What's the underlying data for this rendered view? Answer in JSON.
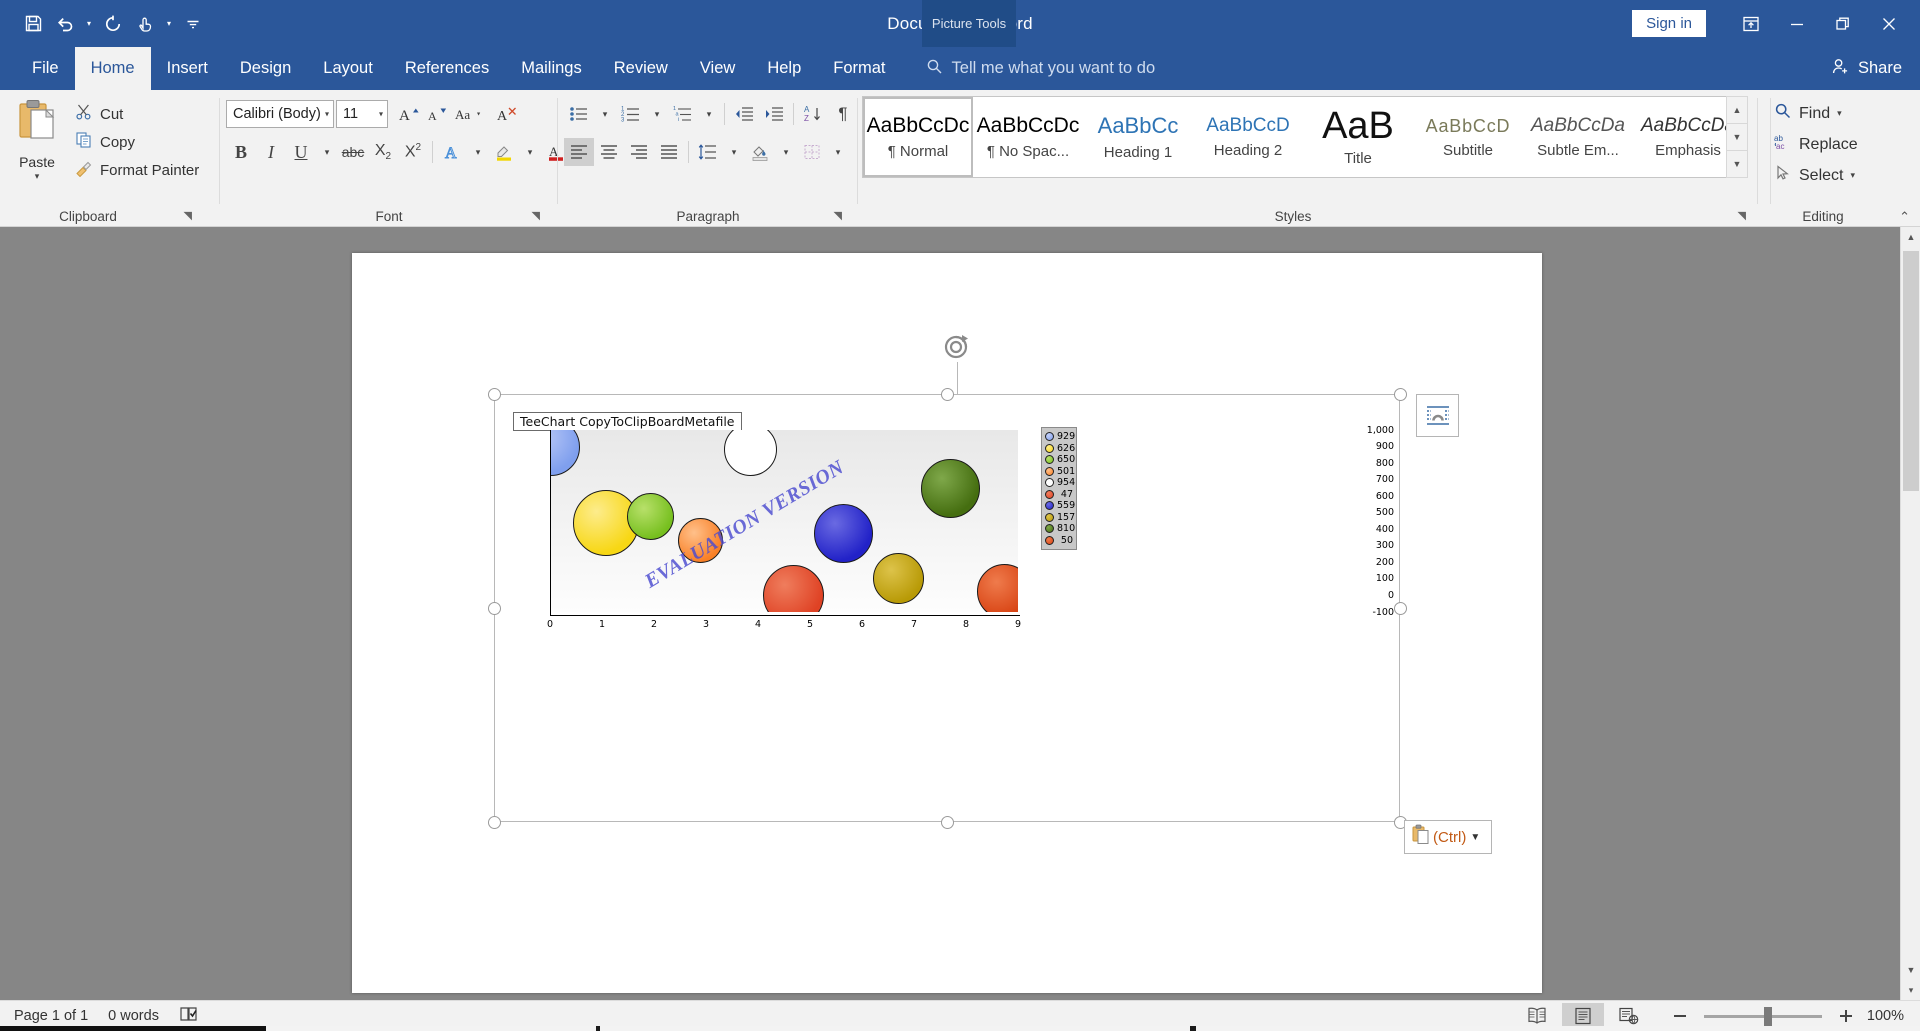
{
  "titlebar": {
    "document_title": "Document1  -  Word",
    "quick_access": [
      {
        "name": "save-icon",
        "label": "Save"
      },
      {
        "name": "undo-icon",
        "label": "Undo"
      },
      {
        "name": "redo-icon",
        "label": "Repeat"
      },
      {
        "name": "touch-mode-icon",
        "label": "Touch/Mouse Mode"
      },
      {
        "name": "customize-qat-icon",
        "label": "Customize Quick Access Toolbar"
      }
    ],
    "contextual_tab_group": "Picture Tools",
    "sign_in": "Sign in",
    "window_buttons": [
      {
        "name": "ribbon-display-options-icon",
        "label": "Ribbon Display Options"
      },
      {
        "name": "minimize-icon",
        "label": "Minimize"
      },
      {
        "name": "restore-icon",
        "label": "Restore Down"
      },
      {
        "name": "close-icon",
        "label": "Close"
      }
    ]
  },
  "tabs": [
    {
      "label": "File",
      "active": false
    },
    {
      "label": "Home",
      "active": true
    },
    {
      "label": "Insert",
      "active": false
    },
    {
      "label": "Design",
      "active": false
    },
    {
      "label": "Layout",
      "active": false
    },
    {
      "label": "References",
      "active": false
    },
    {
      "label": "Mailings",
      "active": false
    },
    {
      "label": "Review",
      "active": false
    },
    {
      "label": "View",
      "active": false
    },
    {
      "label": "Help",
      "active": false
    },
    {
      "label": "Format",
      "active": false,
      "contextual": true
    }
  ],
  "tell_me": {
    "placeholder": "Tell me what you want to do",
    "icon": "search-icon"
  },
  "share": {
    "label": "Share",
    "icon": "share-person-icon"
  },
  "ribbon": {
    "clipboard": {
      "group_label": "Clipboard",
      "paste_label": "Paste",
      "items": [
        {
          "label": "Cut",
          "icon": "scissors-icon"
        },
        {
          "label": "Copy",
          "icon": "copy-icon"
        },
        {
          "label": "Format Painter",
          "icon": "paintbrush-icon"
        }
      ]
    },
    "font": {
      "group_label": "Font",
      "font_name": "Calibri (Body)",
      "font_size": "11",
      "row1_icons": [
        "grow-font-icon",
        "shrink-font-icon",
        "change-case-icon",
        "clear-formatting-icon"
      ],
      "row2_icons": [
        "bold-icon",
        "italic-icon",
        "underline-icon",
        "strikethrough-icon",
        "subscript-icon",
        "superscript-icon",
        "text-effects-icon",
        "text-highlight-color-icon",
        "font-color-icon"
      ]
    },
    "paragraph": {
      "group_label": "Paragraph",
      "row1_icons": [
        "bullets-icon",
        "numbering-icon",
        "multilevel-list-icon",
        "decrease-indent-icon",
        "increase-indent-icon",
        "sort-icon",
        "show-formatting-marks-icon"
      ],
      "row2_icons": [
        "align-left-icon",
        "align-center-icon",
        "align-right-icon",
        "justify-icon",
        "line-spacing-icon",
        "shading-icon",
        "borders-icon"
      ]
    },
    "styles": {
      "group_label": "Styles",
      "items": [
        {
          "preview": "AaBbCcDc",
          "name": "¶ Normal",
          "selected": true,
          "color": "#000000",
          "style": "normal"
        },
        {
          "preview": "AaBbCcDc",
          "name": "¶ No Spac...",
          "selected": false,
          "color": "#000000",
          "style": "normal"
        },
        {
          "preview": "AaBbCc",
          "name": "Heading 1",
          "selected": false,
          "color": "#2e74b5",
          "style": "h1"
        },
        {
          "preview": "AaBbCcD",
          "name": "Heading 2",
          "selected": false,
          "color": "#2e74b5",
          "style": "h2"
        },
        {
          "preview": "AaB",
          "name": "Title",
          "selected": false,
          "color": "#000000",
          "style": "title"
        },
        {
          "preview": "AaBbCcD",
          "name": "Subtitle",
          "selected": false,
          "color": "#595959",
          "style": "subtitle"
        },
        {
          "preview": "AaBbCcDa",
          "name": "Subtle Em...",
          "selected": false,
          "color": "#404040",
          "style": "italic"
        },
        {
          "preview": "AaBbCcDa",
          "name": "Emphasis",
          "selected": false,
          "color": "#404040",
          "style": "italic"
        }
      ],
      "scroll_icons": [
        "scroll-up-icon",
        "scroll-down-icon",
        "more-styles-icon"
      ]
    },
    "editing": {
      "group_label": "Editing",
      "items": [
        {
          "label": "Find",
          "icon": "search-icon",
          "has_caret": true
        },
        {
          "label": "Replace",
          "icon": "replace-icon",
          "has_caret": false
        },
        {
          "label": "Select",
          "icon": "cursor-select-icon",
          "has_caret": true
        }
      ],
      "collapse_icon": "collapse-ribbon-icon"
    }
  },
  "canvas": {
    "layout_options_icon": "picture-layout-options-icon",
    "paste_options": {
      "label": "(Ctrl)",
      "icon": "clipboard-icon",
      "caret": "▾"
    },
    "rotate_handle_icon": "rotate-handle-icon"
  },
  "chart_data": {
    "type": "scatter",
    "title": "TeeChart CopyToClipBoardMetafile",
    "watermark": "EVALUATION VERSION",
    "xlabel": "",
    "ylabel": "",
    "xlim": [
      0,
      9
    ],
    "ylim": [
      -100,
      1000
    ],
    "xticks": [
      "0",
      "1",
      "2",
      "3",
      "4",
      "5",
      "6",
      "7",
      "8",
      "9"
    ],
    "yticks": [
      "1,000",
      "900",
      "800",
      "700",
      "600",
      "500",
      "400",
      "300",
      "200",
      "100",
      "0",
      "-100"
    ],
    "grid": false,
    "legend_position": "right",
    "legend": [
      "929",
      "626",
      "650",
      "501",
      "954",
      "47",
      "559",
      "157",
      "810",
      "50"
    ],
    "series": [
      {
        "name": "929",
        "x": 0,
        "y": 929,
        "radius": 29,
        "color": "#7f9fee"
      },
      {
        "name": "626",
        "x": 0.85,
        "y": 626,
        "radius": 32,
        "color": "#f7d714"
      },
      {
        "name": "650",
        "x": 1.95,
        "y": 650,
        "radius": 23,
        "color": "#7bc game"
      },
      {
        "name": "501",
        "x": 2.95,
        "y": 501,
        "radius": 22,
        "color": "#f98026"
      },
      {
        "name": "954",
        "x": 3.95,
        "y": 954,
        "radius": 26,
        "color": "#ffffff"
      },
      {
        "name": "47",
        "x": 4.9,
        "y": 47,
        "radius": 30,
        "color": "#df4224"
      },
      {
        "name": "559",
        "x": 5.9,
        "y": 559,
        "radius": 29,
        "color": "#2222c8"
      },
      {
        "name": "157",
        "x": 7.0,
        "y": 157,
        "radius": 25,
        "color": "#b89a06"
      },
      {
        "name": "810",
        "x": 8.0,
        "y": 810,
        "radius": 29,
        "color": "#456e10"
      },
      {
        "name": "50",
        "x": 9.0,
        "y": 50,
        "radius": 27,
        "color": "#d84414"
      }
    ]
  },
  "statusbar": {
    "page": "Page 1 of 1",
    "words": "0 words",
    "proofing_icon": "proofing-errors-icon",
    "views": [
      {
        "name": "read-mode-icon",
        "active": false
      },
      {
        "name": "print-layout-icon",
        "active": true
      },
      {
        "name": "web-layout-icon",
        "active": false
      }
    ],
    "zoom_out_icon": "zoom-out-icon",
    "zoom_in_icon": "zoom-in-icon",
    "zoom_level": "100%"
  }
}
